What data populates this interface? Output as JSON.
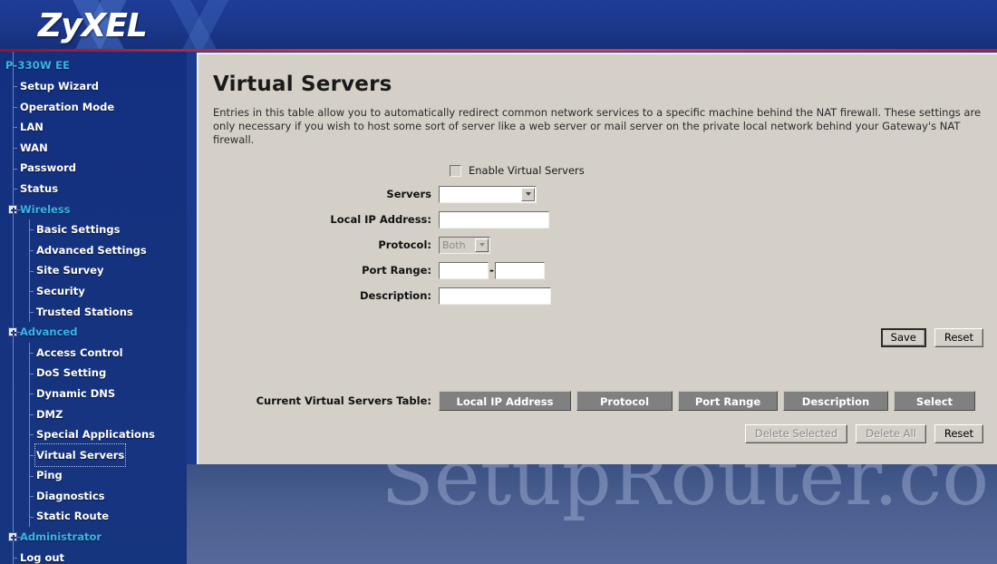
{
  "banner": {
    "logo": "ZyXEL"
  },
  "sidebar": {
    "model": "P-330W EE",
    "items": [
      {
        "label": "Setup Wizard",
        "level": 1,
        "type": "link",
        "active": false
      },
      {
        "label": "Operation Mode",
        "level": 1,
        "type": "link",
        "active": false
      },
      {
        "label": "LAN",
        "level": 1,
        "type": "link",
        "active": false
      },
      {
        "label": "WAN",
        "level": 1,
        "type": "link",
        "active": false
      },
      {
        "label": "Password",
        "level": 1,
        "type": "link",
        "active": false
      },
      {
        "label": "Status",
        "level": 1,
        "type": "link",
        "active": false
      },
      {
        "label": "Wireless",
        "level": 1,
        "type": "group",
        "active": false
      },
      {
        "label": "Basic Settings",
        "level": 2,
        "type": "link",
        "active": false
      },
      {
        "label": "Advanced Settings",
        "level": 2,
        "type": "link",
        "active": false
      },
      {
        "label": "Site Survey",
        "level": 2,
        "type": "link",
        "active": false
      },
      {
        "label": "Security",
        "level": 2,
        "type": "link",
        "active": false
      },
      {
        "label": "Trusted Stations",
        "level": 2,
        "type": "link",
        "active": false
      },
      {
        "label": "Advanced",
        "level": 1,
        "type": "group",
        "active": false
      },
      {
        "label": "Access Control",
        "level": 2,
        "type": "link",
        "active": false
      },
      {
        "label": "DoS Setting",
        "level": 2,
        "type": "link",
        "active": false
      },
      {
        "label": "Dynamic DNS",
        "level": 2,
        "type": "link",
        "active": false
      },
      {
        "label": "DMZ",
        "level": 2,
        "type": "link",
        "active": false
      },
      {
        "label": "Special Applications",
        "level": 2,
        "type": "link",
        "active": false
      },
      {
        "label": "Virtual Servers",
        "level": 2,
        "type": "link",
        "active": true
      },
      {
        "label": "Ping",
        "level": 2,
        "type": "link",
        "active": false
      },
      {
        "label": "Diagnostics",
        "level": 2,
        "type": "link",
        "active": false
      },
      {
        "label": "Static Route",
        "level": 2,
        "type": "link",
        "active": false
      },
      {
        "label": "Administrator",
        "level": 1,
        "type": "group",
        "active": false
      },
      {
        "label": "Log out",
        "level": 1,
        "type": "link",
        "active": false
      }
    ]
  },
  "main": {
    "title": "Virtual Servers",
    "description": "Entries in this table allow you to automatically redirect common network services to a specific machine behind the NAT firewall. These settings are only necessary if you wish to host some sort of server like a web server or mail server on the private local network behind your Gateway's NAT firewall.",
    "form": {
      "enable_checkbox_label": "Enable Virtual Servers",
      "enable_checked": false,
      "servers_label": "Servers",
      "servers_value": "",
      "local_ip_label": "Local IP Address:",
      "local_ip_value": "",
      "protocol_label": "Protocol:",
      "protocol_value": "Both",
      "protocol_disabled": true,
      "port_range_label": "Port Range:",
      "port_range_start": "",
      "port_range_end": "",
      "port_range_separator": "-",
      "description_label": "Description:",
      "description_value": ""
    },
    "form_buttons": {
      "save": "Save",
      "reset": "Reset"
    },
    "table": {
      "label": "Current Virtual Servers Table:",
      "headers": [
        "Local IP Address",
        "Protocol",
        "Port Range",
        "Description",
        "Select"
      ],
      "rows": []
    },
    "table_buttons": {
      "delete_selected": "Delete Selected",
      "delete_selected_disabled": true,
      "delete_all": "Delete All",
      "delete_all_disabled": true,
      "reset": "Reset"
    }
  },
  "watermark": {
    "text": "SetupRouter.co"
  },
  "colors": {
    "banner_blue": "#1b388c",
    "sidebar_blue": "#15327f",
    "accent_cyan": "#39b6e8",
    "rule_red": "#a82240",
    "panel_gray": "#d4d0c8",
    "table_header_gray": "#808080"
  }
}
